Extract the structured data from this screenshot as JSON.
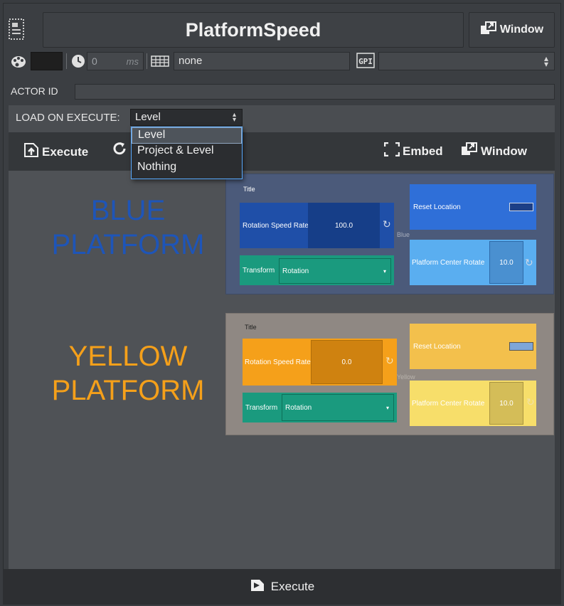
{
  "header": {
    "title": "PlatformSpeed",
    "window_label": "Window"
  },
  "controls": {
    "delay_value": "0",
    "delay_unit": "ms",
    "tag_value": "none",
    "gpi_label": "GPI",
    "gpi_value": ""
  },
  "actor": {
    "label": "ACTOR ID",
    "value": ""
  },
  "load": {
    "label": "LOAD ON EXECUTE:",
    "selected": "Level",
    "options": [
      "Level",
      "Project & Level",
      "Nothing"
    ]
  },
  "toolbar": {
    "execute_label": "Execute",
    "embed_label": "Embed",
    "window_label": "Window"
  },
  "blue": {
    "label_line1": "BLUE",
    "label_line2": "PLATFORM",
    "title": "Title",
    "rotation_label": "Rotation Speed Rate",
    "rotation_value": "100.0",
    "reset_label": "Reset Location",
    "transform_label": "Transform",
    "transform_value": "Rotation",
    "center_label": "Platform Center Rotate",
    "center_value": "10.0",
    "tag": "Blue"
  },
  "yellow": {
    "label_line1": "YELLOW",
    "label_line2": "PLATFORM",
    "title": "Title",
    "rotation_label": "Rotation Speed Rate",
    "rotation_value": "0.0",
    "reset_label": "Reset Location",
    "transform_label": "Transform",
    "transform_value": "Rotation",
    "center_label": "Platform Center Rotate",
    "center_value": "10.0",
    "tag": "Yellow"
  },
  "footer": {
    "execute_label": "Execute"
  },
  "colors": {
    "blue_text": "#1e55b8",
    "yellow_text": "#f5a01a",
    "teal": "#1a9a7e",
    "blue_widget": "#1f4fa8",
    "light_blue": "#5aaef0",
    "orange": "#f5a01a",
    "light_yellow": "#f7de6a"
  }
}
